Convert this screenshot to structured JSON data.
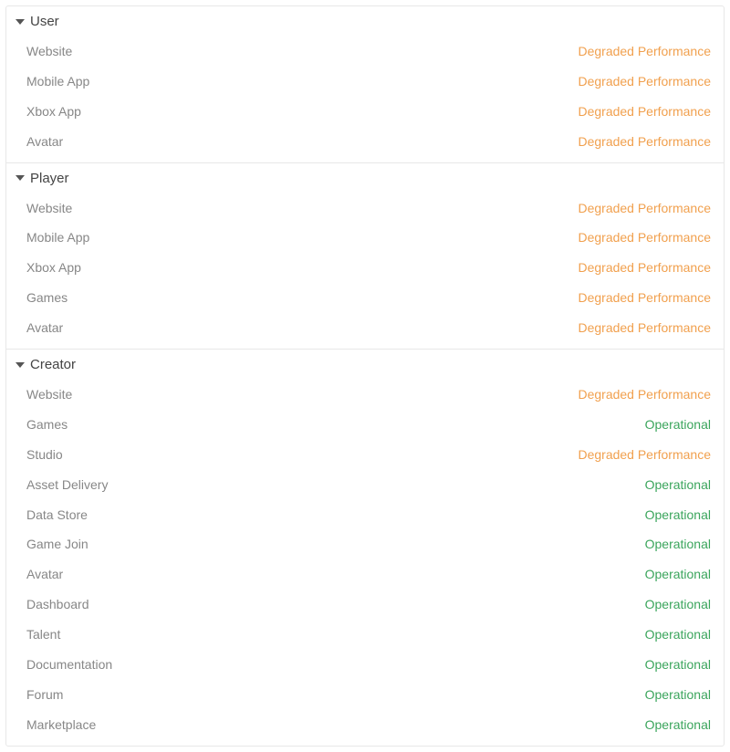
{
  "statuses": {
    "degraded": {
      "label": "Degraded Performance",
      "class": "status-degraded"
    },
    "operational": {
      "label": "Operational",
      "class": "status-operational"
    }
  },
  "groups": [
    {
      "id": "user",
      "title": "User",
      "items": [
        {
          "name": "Website",
          "status": "degraded"
        },
        {
          "name": "Mobile App",
          "status": "degraded"
        },
        {
          "name": "Xbox App",
          "status": "degraded"
        },
        {
          "name": "Avatar",
          "status": "degraded"
        }
      ]
    },
    {
      "id": "player",
      "title": "Player",
      "items": [
        {
          "name": "Website",
          "status": "degraded"
        },
        {
          "name": "Mobile App",
          "status": "degraded"
        },
        {
          "name": "Xbox App",
          "status": "degraded"
        },
        {
          "name": "Games",
          "status": "degraded"
        },
        {
          "name": "Avatar",
          "status": "degraded"
        }
      ]
    },
    {
      "id": "creator",
      "title": "Creator",
      "items": [
        {
          "name": "Website",
          "status": "degraded"
        },
        {
          "name": "Games",
          "status": "operational"
        },
        {
          "name": "Studio",
          "status": "degraded"
        },
        {
          "name": "Asset Delivery",
          "status": "operational"
        },
        {
          "name": "Data Store",
          "status": "operational"
        },
        {
          "name": "Game Join",
          "status": "operational"
        },
        {
          "name": "Avatar",
          "status": "operational"
        },
        {
          "name": "Dashboard",
          "status": "operational"
        },
        {
          "name": "Talent",
          "status": "operational"
        },
        {
          "name": "Documentation",
          "status": "operational"
        },
        {
          "name": "Forum",
          "status": "operational"
        },
        {
          "name": "Marketplace",
          "status": "operational"
        }
      ]
    }
  ]
}
